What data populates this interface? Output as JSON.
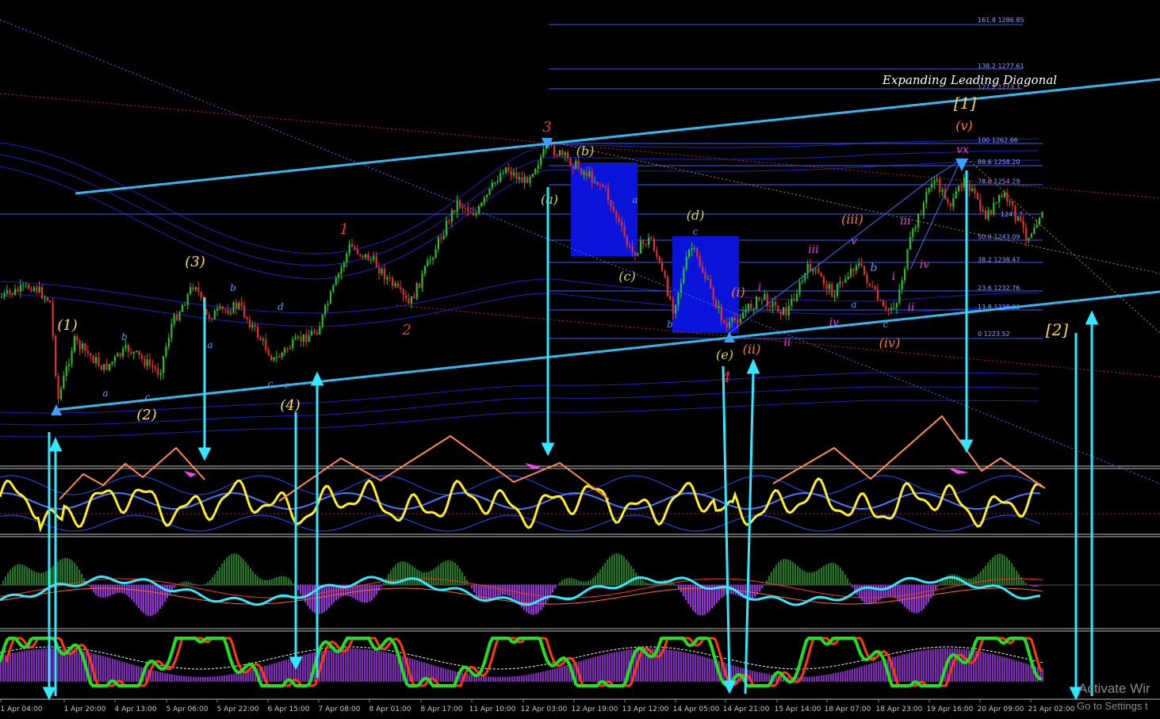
{
  "chart_data": {
    "type": "candlestick",
    "title": "Expanding Leading Diagonal",
    "price_range": [
      1214,
      1295
    ],
    "x_ticks": [
      "1 Apr 04:00",
      "1 Apr 20:00",
      "4 Apr 13:00",
      "5 Apr 06:00",
      "5 Apr 22:00",
      "6 Apr 15:00",
      "7 Apr 08:00",
      "8 Apr 01:00",
      "8 Apr 17:00",
      "11 Apr 10:00",
      "12 Apr 03:00",
      "12 Apr 19:00",
      "13 Apr 12:00",
      "14 Apr 05:00",
      "14 Apr 21:00",
      "15 Apr 14:00",
      "18 Apr 07:00",
      "18 Apr 23:00",
      "19 Apr 16:00",
      "20 Apr 09:00",
      "21 Apr 02:00"
    ],
    "fib_levels": [
      {
        "text": "161.8 1286.85",
        "value": 1286.85
      },
      {
        "text": "138.2 1277.61",
        "value": 1277.61
      },
      {
        "text": "127.2 1273.3",
        "value": 1273.3
      },
      {
        "text": "100 1262.66",
        "value": 1262.66
      },
      {
        "text": "88.6 1258.20",
        "value": 1258.2
      },
      {
        "text": "78.6 1254.29",
        "value": 1254.29
      },
      {
        "text": "1247.7",
        "value": 1247.7
      },
      {
        "text": "50.0 1243.09",
        "value": 1243.09
      },
      {
        "text": "38.2 1238.47",
        "value": 1238.47
      },
      {
        "text": "23.6 1232.76",
        "value": 1232.76
      },
      {
        "text": "13.8 1228.93",
        "value": 1228.93
      },
      {
        "text": "0 1223.52",
        "value": 1223.52
      }
    ],
    "wave_labels": [
      {
        "text": "(1)",
        "color": "#ffe14d"
      },
      {
        "text": "(2)",
        "color": "#ffe14d"
      },
      {
        "text": "(3)",
        "color": "#ffe14d"
      },
      {
        "text": "(4)",
        "color": "#ffe14d"
      },
      {
        "text": "a",
        "color": "#4a9cff"
      },
      {
        "text": "b",
        "color": "#4a9cff"
      },
      {
        "text": "c",
        "color": "#4a9cff"
      },
      {
        "text": "a",
        "color": "#4a9cff"
      },
      {
        "text": "b",
        "color": "#4a9cff"
      },
      {
        "text": "c",
        "color": "#4a9cff"
      },
      {
        "text": "d",
        "color": "#4a9cff"
      },
      {
        "text": "e",
        "color": "#4a9cff"
      },
      {
        "text": "1",
        "color": "#ff3030"
      },
      {
        "text": "2",
        "color": "#ff3030"
      },
      {
        "text": "3",
        "color": "#ff3030"
      },
      {
        "text": "4",
        "color": "#ff3030"
      },
      {
        "text": "(a)",
        "color": "#d7d74a"
      },
      {
        "text": "(b)",
        "color": "#d7d74a"
      },
      {
        "text": "(c)",
        "color": "#d7d74a"
      },
      {
        "text": "(d)",
        "color": "#d7d74a"
      },
      {
        "text": "(e)",
        "color": "#d7d74a"
      },
      {
        "text": "a",
        "color": "#4a9cff"
      },
      {
        "text": "b",
        "color": "#4a9cff"
      },
      {
        "text": "c",
        "color": "#4a9cff"
      },
      {
        "text": "(i)",
        "color": "#ff7a30"
      },
      {
        "text": "(ii)",
        "color": "#ff7a30"
      },
      {
        "text": "(iii)",
        "color": "#ff7a30"
      },
      {
        "text": "(iv)",
        "color": "#ff7a30"
      },
      {
        "text": "(v)",
        "color": "#ff7a30"
      },
      {
        "text": "i",
        "color": "#e040e0"
      },
      {
        "text": "ii",
        "color": "#e040e0"
      },
      {
        "text": "iii",
        "color": "#e040e0"
      },
      {
        "text": "iv",
        "color": "#e040e0"
      },
      {
        "text": "v",
        "color": "#e040e0"
      },
      {
        "text": "b",
        "color": "#4a9cff"
      },
      {
        "text": "a",
        "color": "#4a9cff"
      },
      {
        "text": "c",
        "color": "#4a9cff"
      },
      {
        "text": "i",
        "color": "#e040e0"
      },
      {
        "text": "ii",
        "color": "#e040e0"
      },
      {
        "text": "iii",
        "color": "#e040e0"
      },
      {
        "text": "iv",
        "color": "#e040e0"
      },
      {
        "text": "vx",
        "color": "#e040e0"
      },
      {
        "text": "[1]",
        "color": "#ffd24a"
      },
      {
        "text": "[2]",
        "color": "#ffd24a"
      }
    ],
    "colors": {
      "background": "#000000",
      "bull": "#28c028",
      "bear": "#e03030",
      "trendline": "#35b6ee",
      "fib": "#3a5cff",
      "box": "#0a14d8",
      "osc_yellow": "#ffee22",
      "zigzag": "#ff8a50",
      "osc_green": "#20e020",
      "osc_red": "#ff3a10",
      "hist_purple": "#9a30e0",
      "hist_green": "#1e7a1e",
      "cyan": "#30e8ff"
    },
    "indicator_panes": 3,
    "grid": false
  },
  "watermark": {
    "line1": "Activate Wir",
    "line2": "Go to Settings t"
  }
}
